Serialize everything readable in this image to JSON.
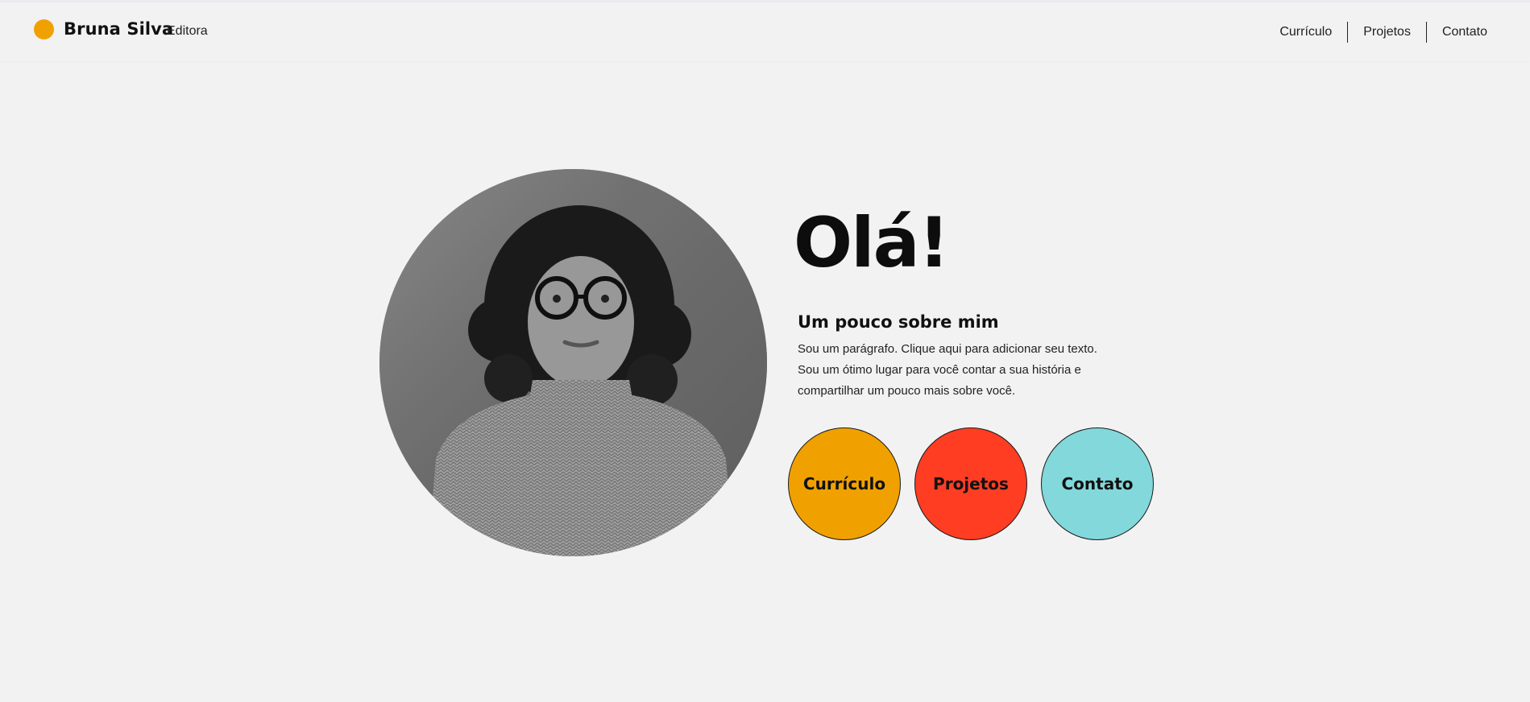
{
  "header": {
    "brand_name": "Bruna Silva",
    "brand_role": "Editora",
    "logo_color": "#f0a100",
    "nav": [
      {
        "label": "Currículo"
      },
      {
        "label": "Projetos"
      },
      {
        "label": "Contato"
      }
    ]
  },
  "hero": {
    "greeting": "Olá!",
    "about_title": "Um pouco sobre mim",
    "about_text": "Sou um parágrafo. Clique aqui para adicionar seu texto. Sou um ótimo lugar para você contar a sua história e compartilhar um pouco mais sobre você.",
    "portrait_icon": "profile-photo",
    "buttons": [
      {
        "label": "Currículo",
        "color": "#f0a100"
      },
      {
        "label": "Projetos",
        "color": "#ff3d23"
      },
      {
        "label": "Contato",
        "color": "#82d8db"
      }
    ]
  }
}
